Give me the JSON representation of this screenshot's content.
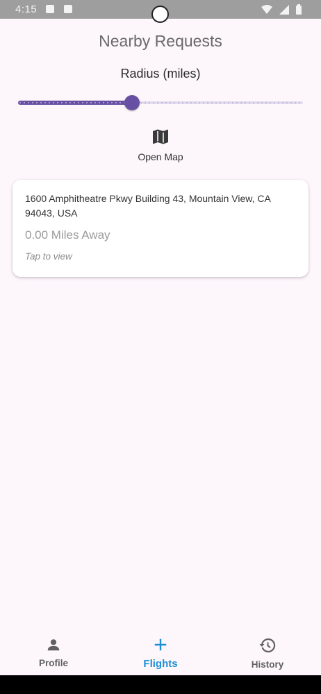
{
  "status_bar": {
    "time": "4:15"
  },
  "page": {
    "title": "Nearby Requests"
  },
  "radius": {
    "label": "Radius (miles)",
    "value_fraction": 0.4
  },
  "map_button": {
    "label": "Open Map",
    "icon": "map-icon"
  },
  "requests": [
    {
      "address": "1600 Amphitheatre Pkwy Building 43, Mountain View, CA 94043, USA",
      "distance": "0.00 Miles Away",
      "hint": "Tap to view"
    }
  ],
  "bottom_nav": {
    "items": [
      {
        "label": "Profile",
        "icon": "person-icon",
        "active": false
      },
      {
        "label": "Flights",
        "icon": "plus-icon",
        "active": true
      },
      {
        "label": "History",
        "icon": "history-icon",
        "active": false
      }
    ],
    "active_color": "#1e8fd6"
  },
  "colors": {
    "accent": "#6750a4",
    "background": "#fdf6fb"
  }
}
